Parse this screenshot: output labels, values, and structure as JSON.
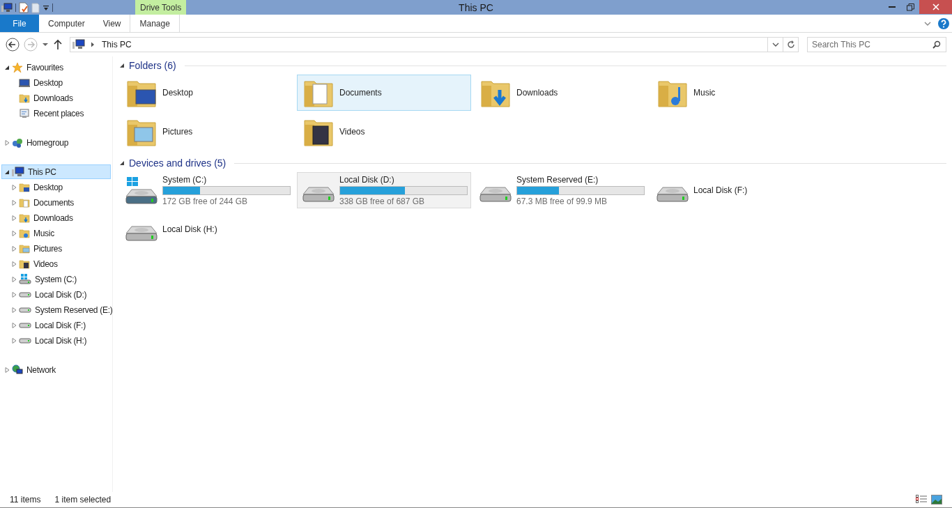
{
  "window": {
    "title": "This PC"
  },
  "ribbon": {
    "file_tab": "File",
    "tabs": [
      {
        "label": "Computer"
      },
      {
        "label": "View"
      }
    ],
    "context_group": {
      "label": "Drive Tools",
      "tabs": [
        {
          "label": "Manage"
        }
      ]
    }
  },
  "address": {
    "path": [
      "This PC"
    ],
    "search_placeholder": "Search This PC"
  },
  "nav_tree": [
    {
      "label": "Favourites",
      "kind": "star",
      "expanded": true,
      "selected": false,
      "children": [
        {
          "label": "Desktop",
          "kind": "monitor",
          "selected": false
        },
        {
          "label": "Downloads",
          "kind": "folder-download",
          "selected": false
        },
        {
          "label": "Recent places",
          "kind": "recent",
          "selected": false
        }
      ]
    },
    {
      "label": "Homegroup",
      "kind": "homegroup",
      "expanded": false,
      "selected": false
    },
    {
      "label": "This PC",
      "kind": "pc",
      "expanded": true,
      "selected": true,
      "children": [
        {
          "label": "Desktop",
          "kind": "folder-desktop",
          "expanded": false,
          "selected": false
        },
        {
          "label": "Documents",
          "kind": "folder-documents",
          "expanded": false,
          "selected": false
        },
        {
          "label": "Downloads",
          "kind": "folder-download",
          "expanded": false,
          "selected": false
        },
        {
          "label": "Music",
          "kind": "folder-music",
          "expanded": false,
          "selected": false
        },
        {
          "label": "Pictures",
          "kind": "folder-pictures",
          "expanded": false,
          "selected": false
        },
        {
          "label": "Videos",
          "kind": "folder-videos",
          "expanded": false,
          "selected": false
        },
        {
          "label": "System  (C:)",
          "kind": "drive-windows",
          "expanded": false,
          "selected": false
        },
        {
          "label": "Local Disk (D:)",
          "kind": "drive",
          "expanded": false,
          "selected": false
        },
        {
          "label": "System Reserved (E:)",
          "kind": "drive",
          "expanded": false,
          "selected": false
        },
        {
          "label": "Local Disk (F:)",
          "kind": "drive",
          "expanded": false,
          "selected": false
        },
        {
          "label": "Local Disk (H:)",
          "kind": "drive",
          "expanded": false,
          "selected": false
        }
      ]
    },
    {
      "label": "Network",
      "kind": "network",
      "expanded": false,
      "selected": false
    }
  ],
  "groups": [
    {
      "title": "Folders (6)",
      "expanded": true,
      "items": [
        {
          "name": "Desktop",
          "kind": "folder-desktop",
          "selected": false,
          "hovered": false
        },
        {
          "name": "Documents",
          "kind": "folder-documents",
          "selected": false,
          "hovered": true
        },
        {
          "name": "Downloads",
          "kind": "folder-download",
          "selected": false,
          "hovered": false
        },
        {
          "name": "Music",
          "kind": "folder-music",
          "selected": false,
          "hovered": false
        },
        {
          "name": "Pictures",
          "kind": "folder-pictures",
          "selected": false,
          "hovered": false
        },
        {
          "name": "Videos",
          "kind": "folder-videos",
          "selected": false,
          "hovered": false
        }
      ]
    },
    {
      "title": "Devices and drives (5)",
      "expanded": true,
      "items": [
        {
          "name": "System  (C:)",
          "kind": "drive-windows",
          "level": 0.29,
          "free": "172 GB free of 244 GB",
          "selected": false,
          "hovered": false
        },
        {
          "name": "Local Disk (D:)",
          "kind": "drive",
          "level": 0.51,
          "free": "338 GB free of 687 GB",
          "selected": true,
          "hovered": false
        },
        {
          "name": "System Reserved (E:)",
          "kind": "drive",
          "level": 0.33,
          "free": "67.3 MB free of 99.9 MB",
          "selected": false,
          "hovered": false
        },
        {
          "name": "Local Disk (F:)",
          "kind": "drive",
          "selected": false,
          "hovered": false
        },
        {
          "name": "Local Disk (H:)",
          "kind": "drive",
          "selected": false,
          "hovered": false
        }
      ]
    }
  ],
  "status_bar": {
    "count": "11 items",
    "selection": "1 item selected"
  }
}
